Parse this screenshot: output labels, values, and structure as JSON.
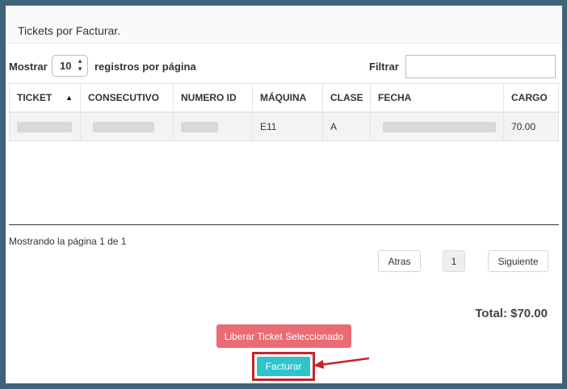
{
  "panel": {
    "title": "Tickets por Facturar."
  },
  "length_control": {
    "prefix": "Mostrar",
    "value": "10",
    "suffix": "registros por página"
  },
  "filter": {
    "label": "Filtrar",
    "value": ""
  },
  "table": {
    "headers": [
      "TICKET",
      "CONSECUTIVO",
      "NUMERO ID",
      "MÁQUINA",
      "CLASE",
      "FECHA",
      "CARGO"
    ],
    "sorted_column": "TICKET",
    "sort_direction": "ascending",
    "rows": [
      {
        "ticket": "",
        "consecutivo": "",
        "numero_id": "",
        "maquina": "E11",
        "clase": "A",
        "fecha": "",
        "cargo": "70.00"
      }
    ]
  },
  "pagination": {
    "info": "Mostrando la página 1 de 1",
    "prev_label": "Atras",
    "current_page": "1",
    "next_label": "Siguiente"
  },
  "summary": {
    "total": "Total: $70.00"
  },
  "actions": {
    "release_label": "Liberar Ticket Seleccionado",
    "invoice_label": "Facturar"
  },
  "colors": {
    "background": "#3d6479",
    "release_button": "#e96b74",
    "invoice_button": "#2fc3ca",
    "highlight": "#c8232c"
  }
}
